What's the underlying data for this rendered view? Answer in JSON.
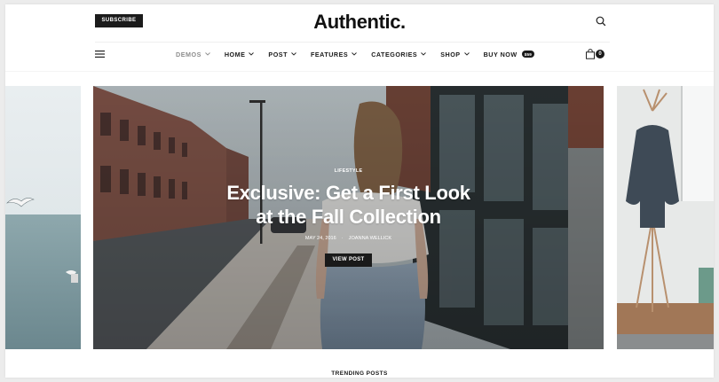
{
  "header": {
    "subscribe_label": "SUBSCRIBE",
    "logo": "Authentic.",
    "search_icon": "search-icon",
    "menu_icon": "hamburger-icon"
  },
  "nav": {
    "items": [
      {
        "label": "DEMOS",
        "active": true
      },
      {
        "label": "HOME"
      },
      {
        "label": "POST"
      },
      {
        "label": "FEATURES"
      },
      {
        "label": "CATEGORIES"
      },
      {
        "label": "SHOP"
      },
      {
        "label": "BUY NOW"
      }
    ],
    "buy_badge": "$59",
    "cart_count": "0"
  },
  "hero": {
    "category": "LIFESTYLE",
    "title_line1": "Exclusive: Get a First Look",
    "title_line2": "at the Fall Collection",
    "date": "MAY 24, 2016",
    "separator": "·",
    "author": "JOANNA WELLICK",
    "button_label": "VIEW POST"
  },
  "section": {
    "trending_label": "TRENDING POSTS"
  },
  "colors": {
    "accent_dark": "#1a1a1a",
    "muted_nav": "#8d8d8d"
  }
}
